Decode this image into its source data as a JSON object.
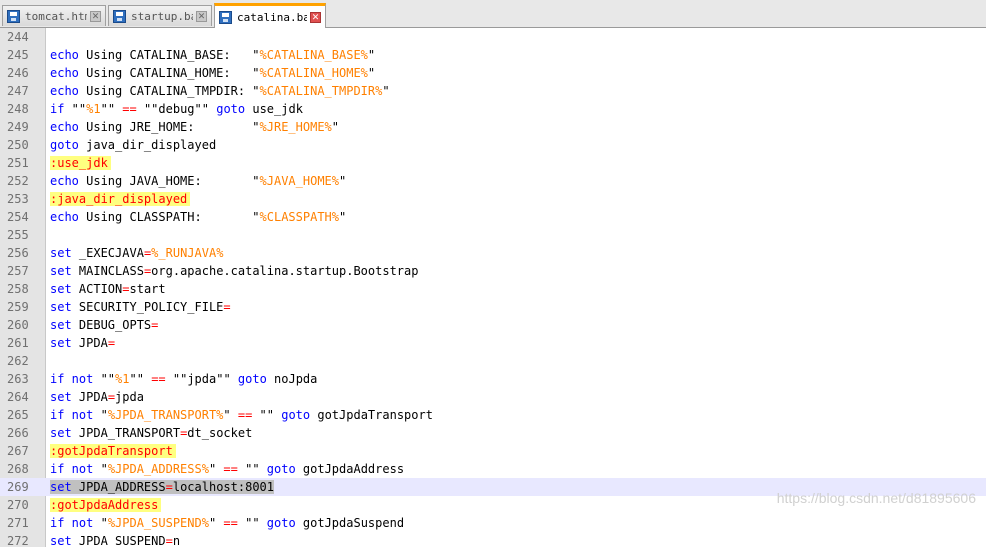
{
  "tabs": [
    {
      "label": "tomcat.html",
      "active": false
    },
    {
      "label": "startup.bat",
      "active": false
    },
    {
      "label": "catalina.bat",
      "active": true
    }
  ],
  "current_line": "269",
  "lines": [
    {
      "num": "244",
      "parts": []
    },
    {
      "num": "245",
      "parts": [
        [
          "kw",
          "echo"
        ],
        [
          "t",
          " Using CATALINA_BASE:   \""
        ],
        [
          "var",
          "%CATALINA_BASE%"
        ],
        [
          "t",
          "\""
        ]
      ]
    },
    {
      "num": "246",
      "parts": [
        [
          "kw",
          "echo"
        ],
        [
          "t",
          " Using CATALINA_HOME:   \""
        ],
        [
          "var",
          "%CATALINA_HOME%"
        ],
        [
          "t",
          "\""
        ]
      ]
    },
    {
      "num": "247",
      "parts": [
        [
          "kw",
          "echo"
        ],
        [
          "t",
          " Using CATALINA_TMPDIR: \""
        ],
        [
          "var",
          "%CATALINA_TMPDIR%"
        ],
        [
          "t",
          "\""
        ]
      ]
    },
    {
      "num": "248",
      "parts": [
        [
          "kw",
          "if"
        ],
        [
          "t",
          " \"\""
        ],
        [
          "var",
          "%1"
        ],
        [
          "t",
          "\"\" "
        ],
        [
          "op",
          "=="
        ],
        [
          "t",
          " \"\"debug\"\" "
        ],
        [
          "kw",
          "goto"
        ],
        [
          "t",
          " use_jdk"
        ]
      ]
    },
    {
      "num": "249",
      "parts": [
        [
          "kw",
          "echo"
        ],
        [
          "t",
          " Using JRE_HOME:        \""
        ],
        [
          "var",
          "%JRE_HOME%"
        ],
        [
          "t",
          "\""
        ]
      ]
    },
    {
      "num": "250",
      "parts": [
        [
          "kw",
          "goto"
        ],
        [
          "t",
          " java_dir_displayed"
        ]
      ]
    },
    {
      "num": "251",
      "parts": [
        [
          "label",
          ":use_jdk"
        ]
      ]
    },
    {
      "num": "252",
      "parts": [
        [
          "kw",
          "echo"
        ],
        [
          "t",
          " Using JAVA_HOME:       \""
        ],
        [
          "var",
          "%JAVA_HOME%"
        ],
        [
          "t",
          "\""
        ]
      ]
    },
    {
      "num": "253",
      "parts": [
        [
          "label",
          ":java_dir_displayed"
        ]
      ]
    },
    {
      "num": "254",
      "parts": [
        [
          "kw",
          "echo"
        ],
        [
          "t",
          " Using CLASSPATH:       \""
        ],
        [
          "var",
          "%CLASSPATH%"
        ],
        [
          "t",
          "\""
        ]
      ]
    },
    {
      "num": "255",
      "parts": []
    },
    {
      "num": "256",
      "parts": [
        [
          "kw",
          "set"
        ],
        [
          "t",
          " _EXECJAVA"
        ],
        [
          "op",
          "="
        ],
        [
          "var",
          "%_RUNJAVA%"
        ]
      ]
    },
    {
      "num": "257",
      "parts": [
        [
          "kw",
          "set"
        ],
        [
          "t",
          " MAINCLASS"
        ],
        [
          "op",
          "="
        ],
        [
          "t",
          "org.apache.catalina.startup.Bootstrap"
        ]
      ]
    },
    {
      "num": "258",
      "parts": [
        [
          "kw",
          "set"
        ],
        [
          "t",
          " ACTION"
        ],
        [
          "op",
          "="
        ],
        [
          "t",
          "start"
        ]
      ]
    },
    {
      "num": "259",
      "parts": [
        [
          "kw",
          "set"
        ],
        [
          "t",
          " SECURITY_POLICY_FILE"
        ],
        [
          "op",
          "="
        ]
      ]
    },
    {
      "num": "260",
      "parts": [
        [
          "kw",
          "set"
        ],
        [
          "t",
          " DEBUG_OPTS"
        ],
        [
          "op",
          "="
        ]
      ]
    },
    {
      "num": "261",
      "parts": [
        [
          "kw",
          "set"
        ],
        [
          "t",
          " JPDA"
        ],
        [
          "op",
          "="
        ]
      ]
    },
    {
      "num": "262",
      "parts": []
    },
    {
      "num": "263",
      "parts": [
        [
          "kw",
          "if not"
        ],
        [
          "t",
          " \"\""
        ],
        [
          "var",
          "%1"
        ],
        [
          "t",
          "\"\" "
        ],
        [
          "op",
          "=="
        ],
        [
          "t",
          " \"\"jpda\"\" "
        ],
        [
          "kw",
          "goto"
        ],
        [
          "t",
          " noJpda"
        ]
      ]
    },
    {
      "num": "264",
      "parts": [
        [
          "kw",
          "set"
        ],
        [
          "t",
          " JPDA"
        ],
        [
          "op",
          "="
        ],
        [
          "t",
          "jpda"
        ]
      ]
    },
    {
      "num": "265",
      "parts": [
        [
          "kw",
          "if not"
        ],
        [
          "t",
          " \""
        ],
        [
          "var",
          "%JPDA_TRANSPORT%"
        ],
        [
          "t",
          "\" "
        ],
        [
          "op",
          "=="
        ],
        [
          "t",
          " \"\" "
        ],
        [
          "kw",
          "goto"
        ],
        [
          "t",
          " gotJpdaTransport"
        ]
      ]
    },
    {
      "num": "266",
      "parts": [
        [
          "kw",
          "set"
        ],
        [
          "t",
          " JPDA_TRANSPORT"
        ],
        [
          "op",
          "="
        ],
        [
          "t",
          "dt_socket"
        ]
      ]
    },
    {
      "num": "267",
      "parts": [
        [
          "label",
          ":gotJpdaTransport"
        ]
      ]
    },
    {
      "num": "268",
      "parts": [
        [
          "kw",
          "if not"
        ],
        [
          "t",
          " \""
        ],
        [
          "var",
          "%JPDA_ADDRESS%"
        ],
        [
          "t",
          "\" "
        ],
        [
          "op",
          "=="
        ],
        [
          "t",
          " \"\" "
        ],
        [
          "kw",
          "goto"
        ],
        [
          "t",
          " gotJpdaAddress"
        ]
      ]
    },
    {
      "num": "269",
      "parts": [
        [
          "selkw",
          "set"
        ],
        [
          "sel",
          " JPDA_ADDRESS"
        ],
        [
          "selop",
          "="
        ],
        [
          "sel",
          "localhost:8001"
        ]
      ]
    },
    {
      "num": "270",
      "parts": [
        [
          "label",
          ":gotJpdaAddress"
        ]
      ]
    },
    {
      "num": "271",
      "parts": [
        [
          "kw",
          "if not"
        ],
        [
          "t",
          " \""
        ],
        [
          "var",
          "%JPDA_SUSPEND%"
        ],
        [
          "t",
          "\" "
        ],
        [
          "op",
          "=="
        ],
        [
          "t",
          " \"\" "
        ],
        [
          "kw",
          "goto"
        ],
        [
          "t",
          " gotJpdaSuspend"
        ]
      ]
    },
    {
      "num": "272",
      "parts": [
        [
          "kw",
          "set"
        ],
        [
          "t",
          " JPDA_SUSPEND"
        ],
        [
          "op",
          "="
        ],
        [
          "t",
          "n"
        ]
      ]
    }
  ],
  "watermark": "https://blog.csdn.net/d81895606",
  "colors": {
    "keyword": "#0000ff",
    "variable": "#ff8000",
    "operator": "#ff0000",
    "label_bg": "#ffff80",
    "current_line_bg": "#e8e8ff",
    "active_tab_accent": "#ffa200"
  }
}
